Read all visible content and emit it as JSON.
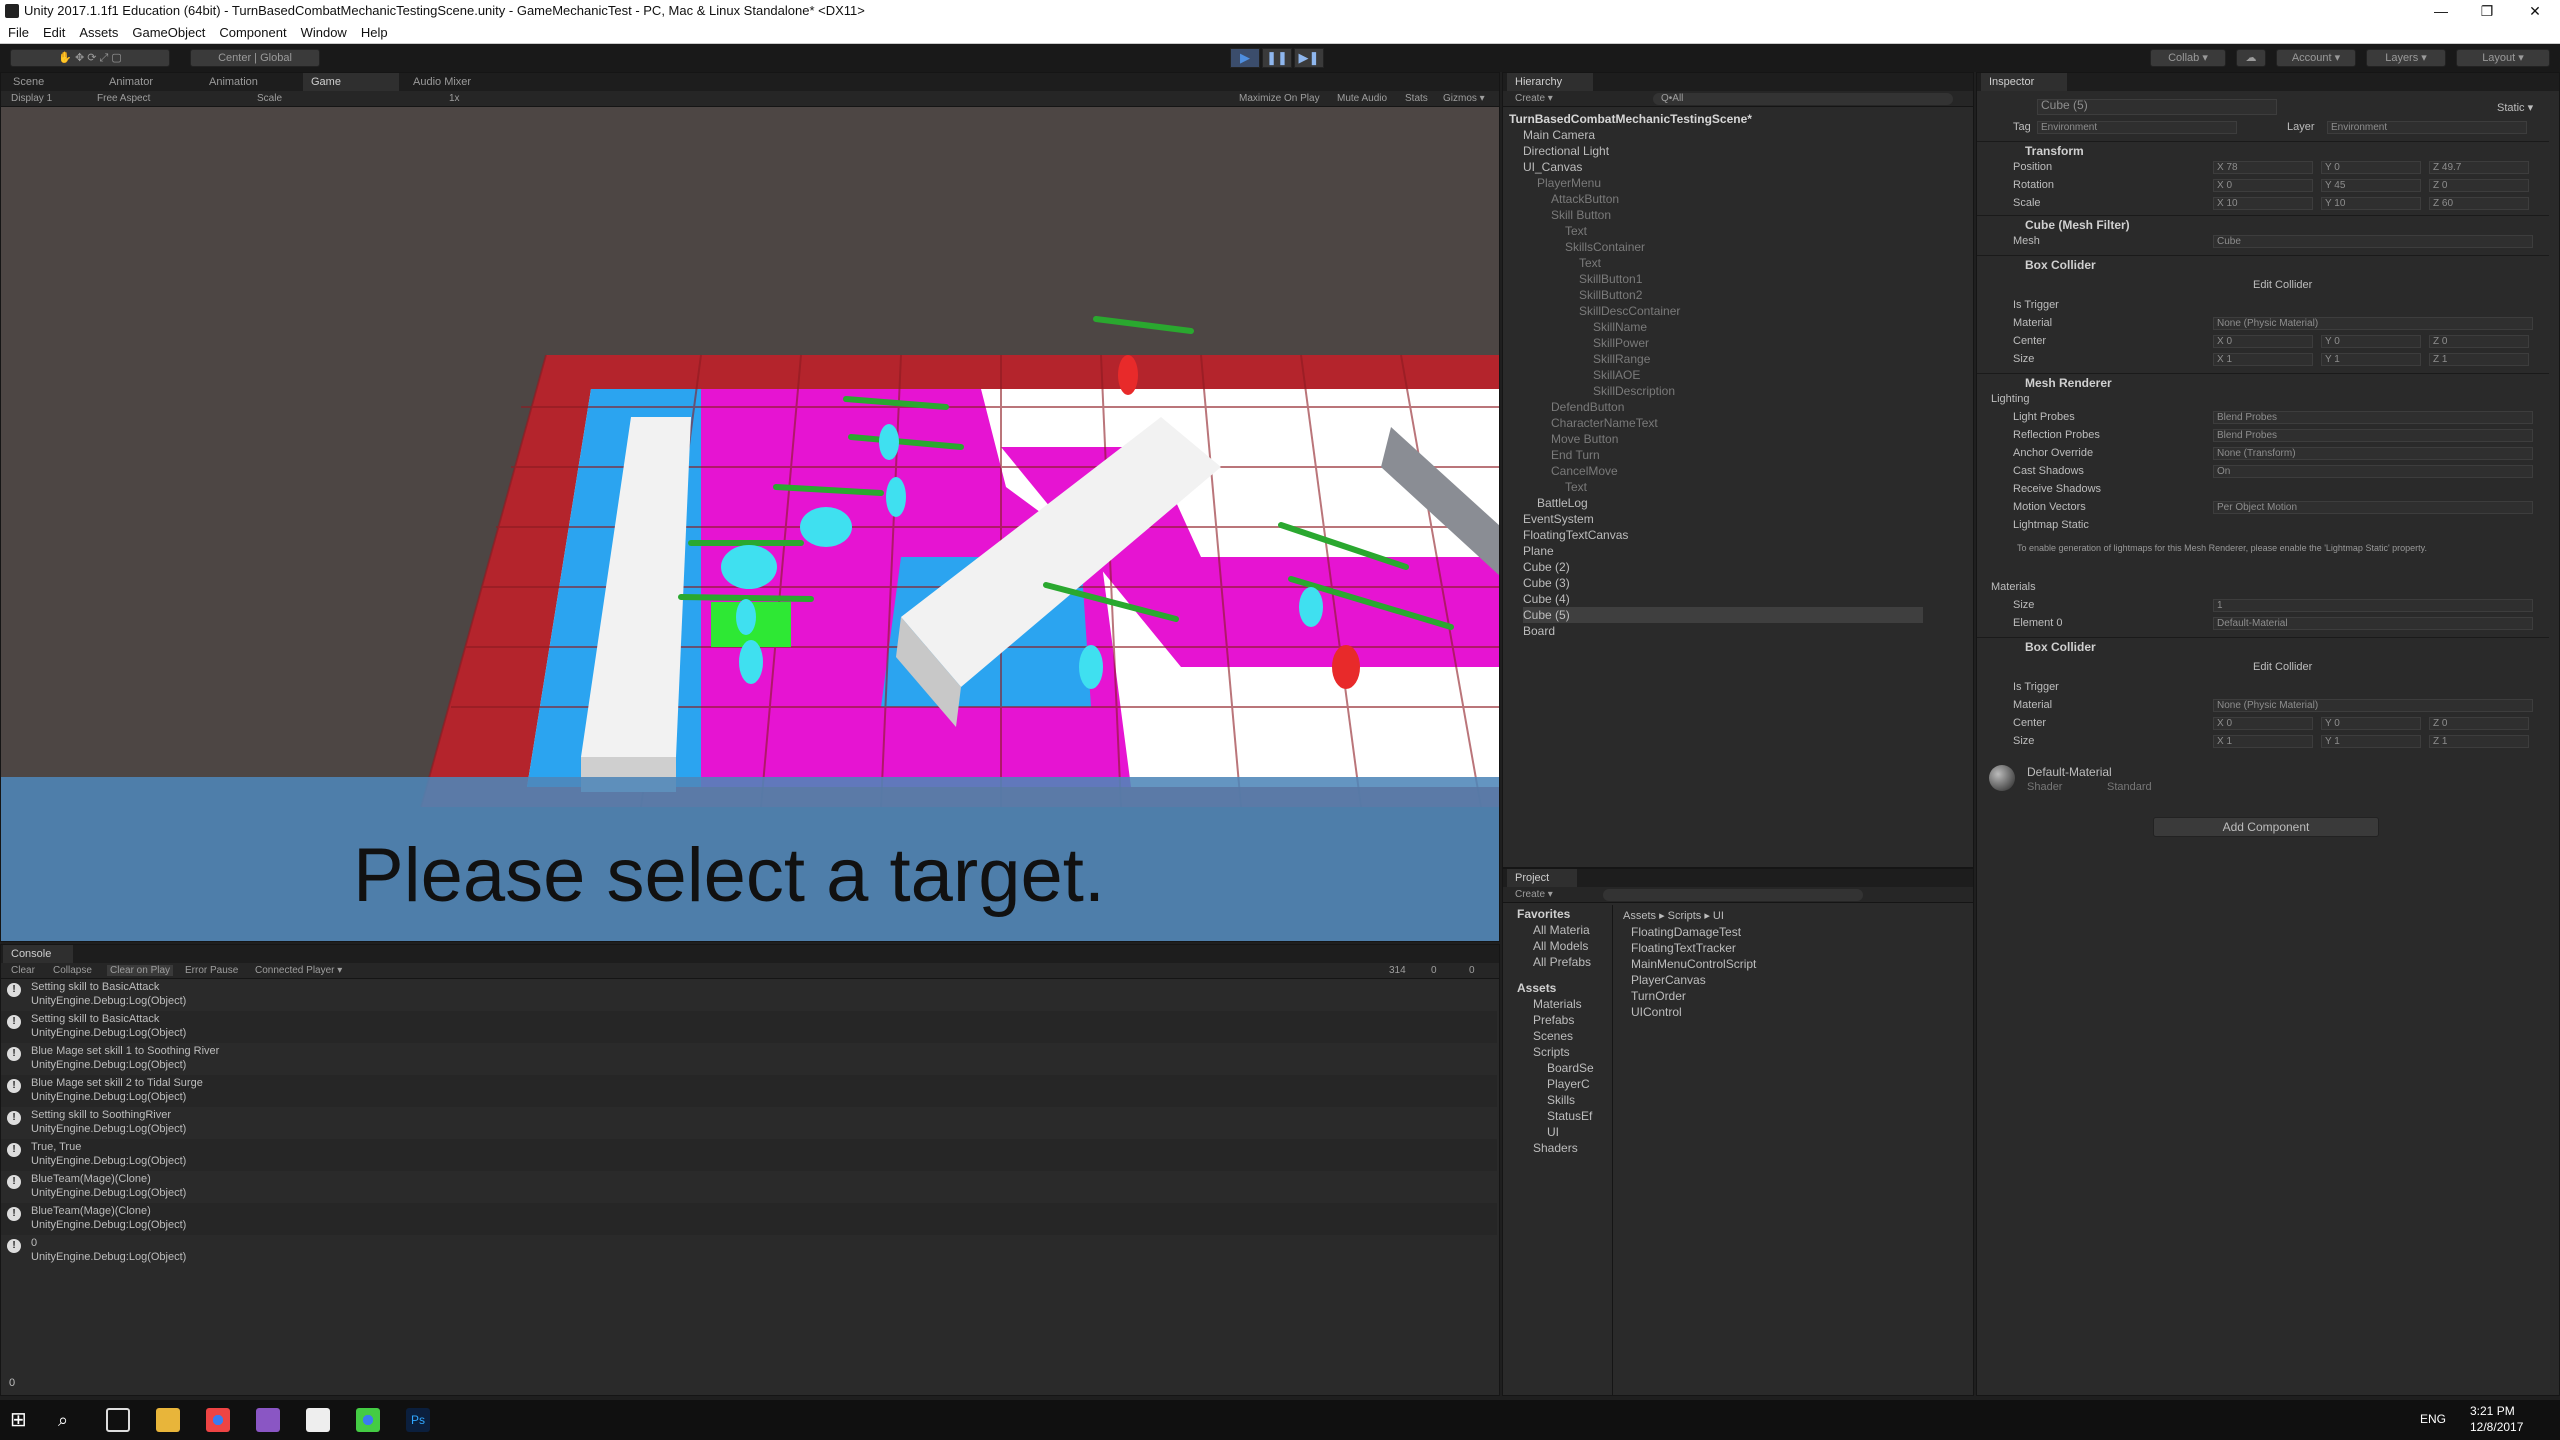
{
  "window": {
    "title": "Unity 2017.1.1f1 Education (64bit) - TurnBasedCombatMechanicTestingScene.unity - GameMechanicTest - PC, Mac & Linux Standalone* <DX11>",
    "minimize": "—",
    "maximize": "❐",
    "close": "✕"
  },
  "menu": [
    "File",
    "Edit",
    "Assets",
    "GameObject",
    "Component",
    "Window",
    "Help"
  ],
  "toolbar": {
    "center": "Center",
    "global": "Global",
    "collab": "Collab ▾",
    "account": "Account ▾",
    "layers": "Layers ▾",
    "layout": "Layout ▾",
    "play": "▶",
    "pause": "❚❚",
    "step": "▶❚"
  },
  "scene_tabs": [
    "Scene",
    "Animator",
    "Animation",
    "Game",
    "Audio Mixer"
  ],
  "game_bar": {
    "display": "Display 1",
    "aspect": "Free Aspect",
    "scale": "Scale",
    "scale_val": "1x",
    "maximize": "Maximize On Play",
    "mute": "Mute Audio",
    "stats": "Stats",
    "gizmos": "Gizmos ▾"
  },
  "game": {
    "prompt": "Please select a target."
  },
  "hierarchy": {
    "tab": "Hierarchy",
    "create": "Create ▾",
    "search_placeholder": "Q•All",
    "scene": "TurnBasedCombatMechanicTestingScene*",
    "items": [
      "Main Camera",
      "Directional Light",
      "UI_Canvas",
      "PlayerMenu",
      "AttackButton",
      "Skill Button",
      "Text",
      "SkillsContainer",
      "Text",
      "SkillButton1",
      "SkillButton2",
      "SkillDescContainer",
      "SkillName",
      "SkillPower",
      "SkillRange",
      "SkillAOE",
      "SkillDescription",
      "DefendButton",
      "CharacterNameText",
      "Move Button",
      "End Turn",
      "CancelMove",
      "Text",
      "BattleLog",
      "EventSystem",
      "FloatingTextCanvas",
      "Plane",
      "Cube (2)",
      "Cube (3)",
      "Cube (4)",
      "Cube (5)",
      "Board"
    ]
  },
  "project": {
    "tab": "Project",
    "create": "Create ▾",
    "favorites": "Favorites",
    "fav_items": [
      "All Materia",
      "All Models",
      "All Prefabs"
    ],
    "assets": "Assets",
    "folders": [
      "Materials",
      "Prefabs",
      "Scenes",
      "Scripts",
      "BoardSe",
      "PlayerC",
      "Skills",
      "StatusEf",
      "UI",
      "Shaders"
    ],
    "breadcrumb": "Assets ▸ Scripts ▸ UI",
    "files": [
      "FloatingDamageTest",
      "FloatingTextTracker",
      "MainMenuControlScript",
      "PlayerCanvas",
      "TurnOrder",
      "UIControl"
    ]
  },
  "inspector": {
    "tab": "Inspector",
    "name": "Cube (5)",
    "static": "Static ▾",
    "tag_label": "Tag",
    "tag": "Environment",
    "layer_label": "Layer",
    "layer": "Environment",
    "transform": "Transform",
    "position": "Position",
    "rotation": "Rotation",
    "scale": "Scale",
    "pos": [
      "X 78",
      "Y 0",
      "Z 49.7"
    ],
    "rot": [
      "X 0",
      "Y 45",
      "Z 0"
    ],
    "scl": [
      "X 10",
      "Y 10",
      "Z 60"
    ],
    "mesh_filter": "Cube (Mesh Filter)",
    "mesh": "Mesh",
    "mesh_val": "Cube",
    "box_collider": "Box Collider",
    "edit_collider": "Edit Collider",
    "is_trigger": "Is Trigger",
    "material": "Material",
    "material_val": "None (Physic Material)",
    "center": "Center",
    "size": "Size",
    "center_vals": [
      "X 0",
      "Y 0",
      "Z 0"
    ],
    "size_vals": [
      "X 1",
      "Y 1",
      "Z 1"
    ],
    "mesh_renderer": "Mesh Renderer",
    "lighting": "Lighting",
    "light_probes": "Light Probes",
    "light_probes_val": "Blend Probes",
    "refl_probes": "Reflection Probes",
    "refl_probes_val": "Blend Probes",
    "anchor": "Anchor Override",
    "anchor_val": "None (Transform)",
    "cast": "Cast Shadows",
    "cast_val": "On",
    "receive": "Receive Shadows",
    "motion": "Motion Vectors",
    "motion_val": "Per Object Motion",
    "lightmap": "Lightmap Static",
    "note": "To enable generation of lightmaps for this Mesh Renderer, please enable the 'Lightmap Static' property.",
    "materials": "Materials",
    "mat_size": "Size",
    "mat_size_val": "1",
    "element0": "Element 0",
    "element0_val": "Default-Material",
    "box_collider2": "Box Collider",
    "default_material": "Default-Material",
    "shader": "Shader",
    "shader_val": "Standard",
    "add_component": "Add Component"
  },
  "console": {
    "tab": "Console",
    "clear": "Clear",
    "collapse": "Collapse",
    "clear_on_play": "Clear on Play",
    "error_pause": "Error Pause",
    "connected": "Connected Player ▾",
    "count_info": "314",
    "count_warn": "0",
    "count_err": "0",
    "rows": [
      {
        "l1": "Setting skill to BasicAttack",
        "l2": "UnityEngine.Debug:Log(Object)"
      },
      {
        "l1": "Setting skill to BasicAttack",
        "l2": "UnityEngine.Debug:Log(Object)"
      },
      {
        "l1": "Blue Mage set skill 1 to Soothing River",
        "l2": "UnityEngine.Debug:Log(Object)"
      },
      {
        "l1": "Blue Mage set skill 2 to Tidal Surge",
        "l2": "UnityEngine.Debug:Log(Object)"
      },
      {
        "l1": "Setting skill to SoothingRiver",
        "l2": "UnityEngine.Debug:Log(Object)"
      },
      {
        "l1": "True, True",
        "l2": "UnityEngine.Debug:Log(Object)"
      },
      {
        "l1": "BlueTeam(Mage)(Clone)",
        "l2": "UnityEngine.Debug:Log(Object)"
      },
      {
        "l1": "BlueTeam(Mage)(Clone)",
        "l2": "UnityEngine.Debug:Log(Object)"
      },
      {
        "l1": "0",
        "l2": "UnityEngine.Debug:Log(Object)"
      }
    ],
    "status": "0"
  },
  "taskbar": {
    "time": "3:21 PM",
    "date": "12/8/2017",
    "lang": "ENG"
  }
}
